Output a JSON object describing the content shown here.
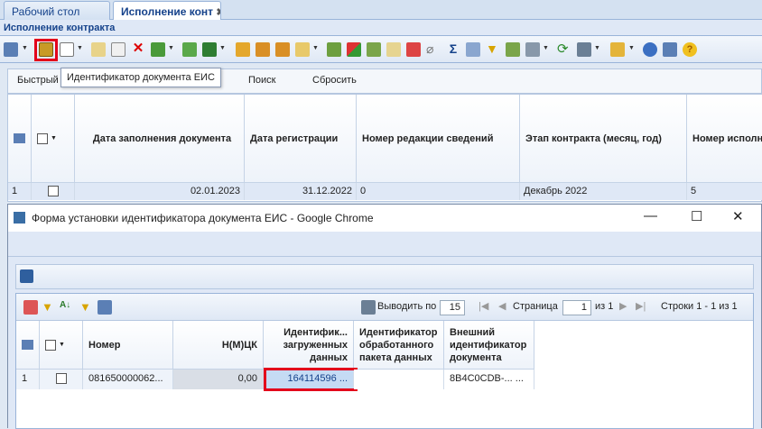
{
  "tabs": [
    {
      "label": "Рабочий стол"
    },
    {
      "label": "Исполнение конт"
    }
  ],
  "panel_title": "Исполнение контракта",
  "tooltip": "Идентификатор документа ЕИС",
  "filter": {
    "quick": "Быстрый",
    "search": "Поиск",
    "reset": "Сбросить"
  },
  "grid": {
    "columns": [
      "Дата заполнения документа",
      "Дата регистрации",
      "Номер редакции сведений",
      "Этап контракта (месяц, год)",
      "Номер исполн"
    ],
    "row": {
      "num": "1",
      "fill_date": "02.01.2023",
      "reg_date": "31.12.2022",
      "edition": "0",
      "stage": "Декабрь 2022",
      "exec_num": "5"
    }
  },
  "window": {
    "title": "Форма установки идентификатора документа ЕИС - Google Chrome",
    "pager": {
      "show_label": "Выводить по",
      "page_size": "15",
      "page_label": "Страница",
      "page": "1",
      "of": "из 1",
      "rows": "Строки 1 - 1 из 1"
    },
    "columns": {
      "number": "Номер",
      "nmck": "Н(М)ЦК",
      "loaded_id": "Идентифик... загруженных данных",
      "processed_id": "Идентификатор обработанного пакета данных",
      "external_id": "Внешний идентификатор документа"
    },
    "row": {
      "num": "1",
      "number": "081650000062...",
      "nmck": "0,00",
      "loaded_id": "164114596",
      "ellipsis": "...",
      "processed_id": "",
      "external_id": "8B4C0CDB-...",
      "ellipsis2": "..."
    }
  },
  "colors": {
    "highlight": "#e3001b",
    "accent": "#15428b"
  }
}
